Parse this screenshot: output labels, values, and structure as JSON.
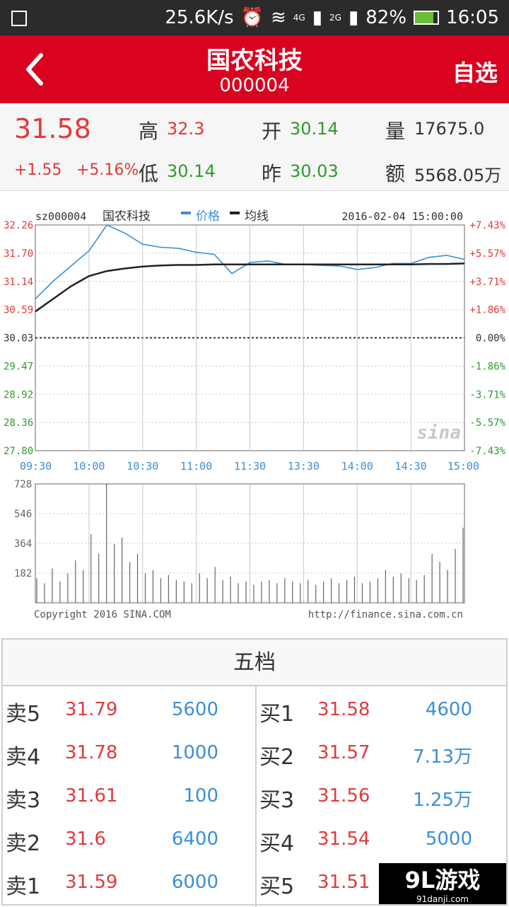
{
  "status": {
    "net_speed": "25.6K/s",
    "net_4g": "4G",
    "net_2g": "2G",
    "battery": "82%",
    "time": "16:05"
  },
  "header": {
    "title": "国农科技",
    "code": "000004",
    "favorite": "自选"
  },
  "quote": {
    "price": "31.58",
    "change": "+1.55",
    "change_pct": "+5.16%",
    "high_label": "高",
    "high": "32.3",
    "low_label": "低",
    "low": "30.14",
    "open_label": "开",
    "open": "30.14",
    "prev_label": "昨",
    "prev": "30.03",
    "vol_label": "量",
    "vol": "17675.0",
    "amt_label": "额",
    "amt": "5568.05万"
  },
  "chart": {
    "symbol": "sz000004",
    "name": "国农科技",
    "legend_price": "价格",
    "legend_avg": "均线",
    "datetime": "2016-02-04 15:00:00",
    "y_left": [
      "32.26",
      "31.70",
      "31.14",
      "30.59",
      "30.03",
      "29.47",
      "28.92",
      "28.36",
      "27.80"
    ],
    "y_right": [
      "+7.43%",
      "+5.57%",
      "+3.71%",
      "+1.86%",
      "0.00%",
      "-1.86%",
      "-3.71%",
      "-5.57%",
      "-7.43%"
    ],
    "x_ticks": [
      "09:30",
      "10:00",
      "10:30",
      "11:00",
      "11:30",
      "13:30",
      "14:00",
      "14:30",
      "15:00"
    ],
    "vol_ticks": [
      "728",
      "546",
      "364",
      "182"
    ],
    "logo": "sina",
    "copyright": "Copyright 2016 SINA.COM",
    "url": "http://finance.sina.com.cn",
    "colors": {
      "price": "#3a8fd8",
      "avg": "#222222",
      "grid": "#c8c8c8",
      "up": "#e03a3a",
      "down": "#2e9a2e"
    }
  },
  "chart_data": [
    {
      "type": "line",
      "ylim": [
        27.8,
        32.26
      ],
      "x": [
        "09:30",
        "09:40",
        "09:50",
        "10:00",
        "10:05",
        "10:10",
        "10:20",
        "10:30",
        "10:40",
        "10:50",
        "11:00",
        "11:05",
        "11:10",
        "11:20",
        "11:30",
        "13:30",
        "13:40",
        "13:50",
        "14:00",
        "14:10",
        "14:20",
        "14:30",
        "14:40",
        "14:50",
        "15:00"
      ],
      "series": [
        {
          "name": "价格",
          "values": [
            30.8,
            31.15,
            31.45,
            31.75,
            32.26,
            32.1,
            31.88,
            31.82,
            31.8,
            31.72,
            31.68,
            31.3,
            31.52,
            31.55,
            31.48,
            31.48,
            31.46,
            31.45,
            31.38,
            31.42,
            31.5,
            31.5,
            31.62,
            31.66,
            31.58
          ]
        },
        {
          "name": "均线",
          "values": [
            30.55,
            30.8,
            31.05,
            31.25,
            31.35,
            31.4,
            31.44,
            31.46,
            31.47,
            31.47,
            31.48,
            31.48,
            31.48,
            31.48,
            31.48,
            31.48,
            31.48,
            31.48,
            31.48,
            31.48,
            31.48,
            31.48,
            31.49,
            31.49,
            31.5
          ]
        }
      ]
    },
    {
      "type": "bar",
      "ylim": [
        0,
        728
      ],
      "values": [
        150,
        120,
        210,
        130,
        180,
        260,
        200,
        420,
        300,
        728,
        360,
        400,
        250,
        300,
        180,
        200,
        150,
        170,
        140,
        130,
        120,
        180,
        150,
        220,
        140,
        160,
        120,
        130,
        110,
        130,
        140,
        120,
        150,
        130,
        120,
        140,
        110,
        130,
        150,
        120,
        140,
        160,
        120,
        130,
        150,
        200,
        160,
        180,
        150,
        140,
        170,
        300,
        250,
        200,
        330,
        460
      ]
    }
  ],
  "book": {
    "title": "五档",
    "sells": [
      {
        "label": "卖5",
        "price": "31.79",
        "vol": "5600"
      },
      {
        "label": "卖4",
        "price": "31.78",
        "vol": "1000"
      },
      {
        "label": "卖3",
        "price": "31.61",
        "vol": "100"
      },
      {
        "label": "卖2",
        "price": "31.6",
        "vol": "6400"
      },
      {
        "label": "卖1",
        "price": "31.59",
        "vol": "6000"
      }
    ],
    "buys": [
      {
        "label": "买1",
        "price": "31.58",
        "vol": "4600"
      },
      {
        "label": "买2",
        "price": "31.57",
        "vol": "7.13万"
      },
      {
        "label": "买3",
        "price": "31.56",
        "vol": "1.25万"
      },
      {
        "label": "买4",
        "price": "31.54",
        "vol": "5000"
      },
      {
        "label": "买5",
        "price": "31.51",
        "vol": ""
      }
    ]
  },
  "watermark": {
    "text": "9L游戏",
    "url": "91danji.com"
  }
}
